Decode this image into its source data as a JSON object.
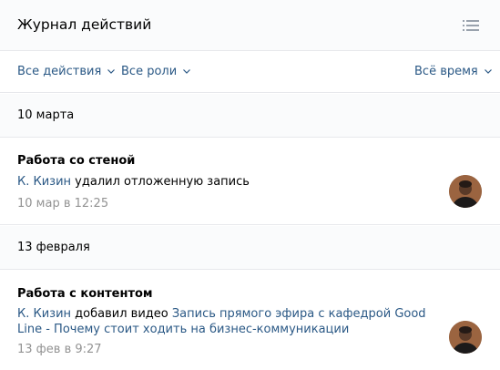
{
  "header": {
    "title": "Журнал действий",
    "menu_icon": "list-icon"
  },
  "filters": {
    "actions": "Все действия",
    "roles": "Все роли",
    "time": "Всё время",
    "chevron_icon": "chevron-down-icon"
  },
  "groups": [
    {
      "date": "10 марта",
      "entry": {
        "title": "Работа со стеной",
        "user": "К. Кизин",
        "action": " удалил отложенную запись",
        "object": "",
        "time": "10 мар в 12:25"
      }
    },
    {
      "date": "13 февраля",
      "entry": {
        "title": "Работа с контентом",
        "user": "К. Кизин",
        "action": " добавил видео ",
        "object": "Запись прямого эфира с кафедрой Good Line - Почему стоит ходить на бизнес-коммуникации",
        "time": "13 фев в 9:27"
      }
    }
  ],
  "colors": {
    "link": "#2a5885",
    "muted": "#939393",
    "header_bg": "#fafbfc",
    "border": "#e7e8ec"
  }
}
